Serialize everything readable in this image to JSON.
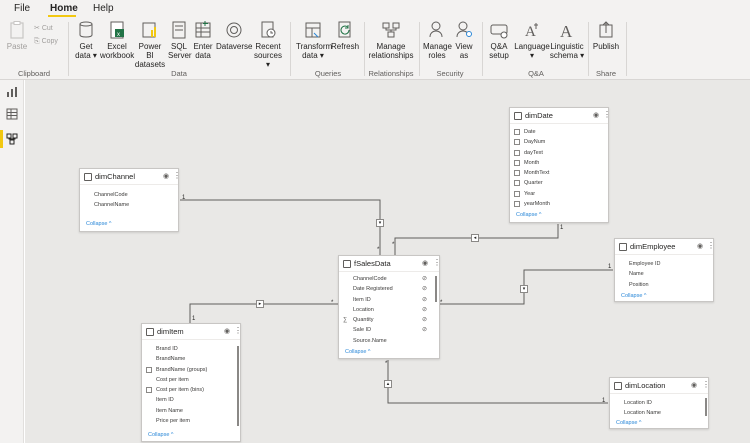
{
  "menu": {
    "items": [
      "File",
      "Home",
      "Help"
    ],
    "active": "Home"
  },
  "clipboard": {
    "paste": "Paste",
    "cut": "Cut",
    "copy": "Copy",
    "group": "Clipboard"
  },
  "data_group": {
    "buttons": [
      {
        "l1": "Get",
        "l2": "data ▾"
      },
      {
        "l1": "Excel",
        "l2": "workbook"
      },
      {
        "l1": "Power BI",
        "l2": "datasets"
      },
      {
        "l1": "SQL",
        "l2": "Server"
      },
      {
        "l1": "Enter",
        "l2": "data"
      },
      {
        "l1": "Dataverse",
        "l2": ""
      },
      {
        "l1": "Recent",
        "l2": "sources ▾"
      }
    ],
    "group": "Data"
  },
  "queries_group": {
    "buttons": [
      {
        "l1": "Transform",
        "l2": "data ▾"
      },
      {
        "l1": "Refresh",
        "l2": ""
      }
    ],
    "group": "Queries"
  },
  "relationships_group": {
    "button": {
      "l1": "Manage",
      "l2": "relationships"
    },
    "group": "Relationships"
  },
  "security_group": {
    "buttons": [
      {
        "l1": "Manage",
        "l2": "roles"
      },
      {
        "l1": "View",
        "l2": "as"
      }
    ],
    "group": "Security"
  },
  "qa_group": {
    "buttons": [
      {
        "l1": "Q&A",
        "l2": "setup"
      },
      {
        "l1": "Language",
        "l2": "▾"
      },
      {
        "l1": "Linguistic",
        "l2": "schema ▾"
      }
    ],
    "group": "Q&A"
  },
  "share_group": {
    "button": {
      "l1": "Publish",
      "l2": ""
    },
    "group": "Share"
  },
  "tables": {
    "dimDate": {
      "title": "dimDate",
      "fields": [
        "Date",
        "DayNum",
        "dayText",
        "Month",
        "MonthText",
        "Quarter",
        "Year",
        "yearMonth"
      ],
      "collapse": "Collapse ^"
    },
    "dimChannel": {
      "title": "dimChannel",
      "fields": [
        "ChannelCode",
        "ChannelName"
      ],
      "collapse": "Collapse ^"
    },
    "fSalesData": {
      "title": "fSalesData",
      "fields": [
        "ChannelCode",
        "Date Registered",
        "Item ID",
        "Location",
        "Quantity",
        "Sale ID",
        "Source.Name"
      ],
      "collapse": "Collapse ^"
    },
    "dimEmployee": {
      "title": "dimEmployee",
      "fields": [
        "Employee ID",
        "Name",
        "Position"
      ],
      "collapse": "Collapse ^"
    },
    "dimItem": {
      "title": "dimItem",
      "fields": [
        "Brand ID",
        "BrandName",
        "BrandName (groups)",
        "Cost per item",
        "Cost per item (bins)",
        "Item ID",
        "Item Name",
        "Price per item"
      ],
      "collapse": "Collapse ^"
    },
    "dimLocation": {
      "title": "dimLocation",
      "fields": [
        "Location ID",
        "Location Name"
      ],
      "collapse": "Collapse ^"
    }
  },
  "relationship_markers": {
    "one": "1",
    "many": "*"
  },
  "colors": {
    "accent": "#f2c811",
    "link": "#2b88d8",
    "canvas": "#e9e8e6",
    "ribbon": "#f3f2f1"
  }
}
